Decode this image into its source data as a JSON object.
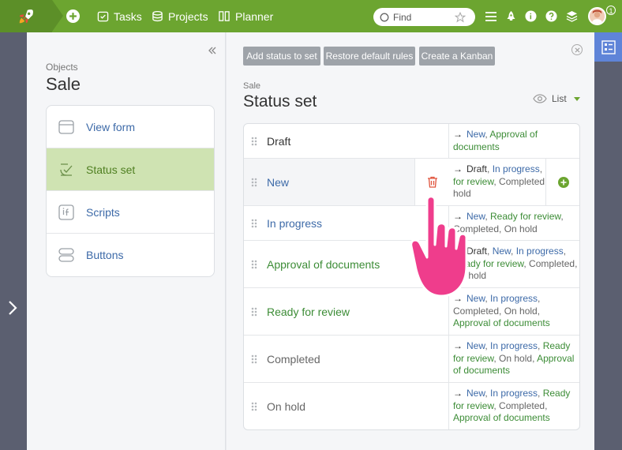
{
  "topbar": {
    "nav": [
      {
        "label": "Tasks",
        "icon": "tasks-icon"
      },
      {
        "label": "Projects",
        "icon": "projects-icon"
      },
      {
        "label": "Planner",
        "icon": "planner-icon"
      }
    ],
    "search_placeholder": "Find",
    "notification_count": "1",
    "accent": "#6ca530"
  },
  "left_panel": {
    "breadcrumb": "Objects",
    "title": "Sale",
    "menu": [
      {
        "label": "View form",
        "icon": "view-form-icon",
        "active": false
      },
      {
        "label": "Status set",
        "icon": "status-set-icon",
        "active": true
      },
      {
        "label": "Scripts",
        "icon": "scripts-icon",
        "active": false
      },
      {
        "label": "Buttons",
        "icon": "buttons-icon",
        "active": false
      }
    ]
  },
  "main": {
    "toolbar": {
      "add_status": "Add status to set",
      "restore_rules": "Restore default rules",
      "create_kanban": "Create a Kanban"
    },
    "breadcrumb": "Sale",
    "title": "Status set",
    "view_label": "List",
    "statuses": [
      {
        "name": "Draft",
        "color": "dark",
        "transitions": [
          {
            "text": "New",
            "color": "blue"
          },
          {
            "text": "Approval of documents",
            "color": "green"
          }
        ]
      },
      {
        "name": "New",
        "color": "blue",
        "transitions": [
          {
            "text": "Draft",
            "color": "dark"
          },
          {
            "text": "In progress",
            "color": "blue"
          },
          {
            "text": "Ready for review",
            "color": "green"
          },
          {
            "text": "Completed",
            "color": "gray"
          },
          {
            "text": "On hold",
            "color": "gray"
          }
        ]
      },
      {
        "name": "In progress",
        "color": "blue",
        "transitions": [
          {
            "text": "New",
            "color": "blue"
          },
          {
            "text": "Ready for review",
            "color": "green"
          },
          {
            "text": "Completed",
            "color": "gray"
          },
          {
            "text": "On hold",
            "color": "gray"
          }
        ]
      },
      {
        "name": "Approval of documents",
        "color": "green",
        "transitions": [
          {
            "text": "Draft",
            "color": "dark"
          },
          {
            "text": "New",
            "color": "blue"
          },
          {
            "text": "In progress",
            "color": "blue"
          },
          {
            "text": "Ready for review",
            "color": "green"
          },
          {
            "text": "Completed",
            "color": "gray"
          },
          {
            "text": "On hold",
            "color": "gray"
          }
        ]
      },
      {
        "name": "Ready for review",
        "color": "green",
        "transitions": [
          {
            "text": "New",
            "color": "blue"
          },
          {
            "text": "In progress",
            "color": "blue"
          },
          {
            "text": "Completed",
            "color": "gray"
          },
          {
            "text": "On hold",
            "color": "gray"
          },
          {
            "text": "Approval of documents",
            "color": "green"
          }
        ]
      },
      {
        "name": "Completed",
        "color": "gray",
        "transitions": [
          {
            "text": "New",
            "color": "blue"
          },
          {
            "text": "In progress",
            "color": "blue"
          },
          {
            "text": "Ready for review",
            "color": "green"
          },
          {
            "text": "On hold",
            "color": "gray"
          },
          {
            "text": "Approval of documents",
            "color": "green"
          }
        ]
      },
      {
        "name": "On hold",
        "color": "gray",
        "transitions": [
          {
            "text": "New",
            "color": "blue"
          },
          {
            "text": "In progress",
            "color": "blue"
          },
          {
            "text": "Ready for review",
            "color": "green"
          },
          {
            "text": "Completed",
            "color": "gray"
          },
          {
            "text": "Approval of documents",
            "color": "green"
          }
        ]
      }
    ]
  }
}
